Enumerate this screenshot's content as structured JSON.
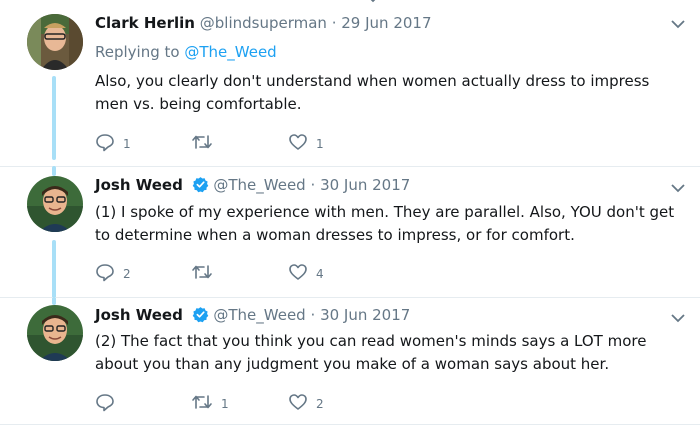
{
  "tweets": [
    {
      "name": "Clark Herlin",
      "handle": "@blindsuperman",
      "separator": "·",
      "date": "29 Jun 2017",
      "verified": false,
      "replying_prefix": "Replying to",
      "replying_to": "@The_Weed",
      "text": "Also, you clearly don't understand when women actually dress to impress men vs. being comfortable.",
      "reply_count": "1",
      "retweet_count": "",
      "like_count": "1"
    },
    {
      "name": "Josh Weed",
      "handle": "@The_Weed",
      "separator": "·",
      "date": "30 Jun 2017",
      "verified": true,
      "text": "(1) I spoke of my experience with men. They are parallel. Also, YOU don't get to determine when a woman dresses to impress, or for comfort.",
      "reply_count": "2",
      "retweet_count": "",
      "like_count": "4"
    },
    {
      "name": "Josh Weed",
      "handle": "@The_Weed",
      "separator": "·",
      "date": "30 Jun 2017",
      "verified": true,
      "text": "(2) The fact that you think you can read women's minds says a LOT more about you than any judgment you make of a woman says about her.",
      "reply_count": "",
      "retweet_count": "1",
      "like_count": "2"
    }
  ],
  "icons": {
    "reply": "reply-icon",
    "retweet": "retweet-icon",
    "like": "heart-icon",
    "more": "chevron-down-icon",
    "verified": "verified-badge-icon"
  },
  "colors": {
    "name": "#14171a",
    "secondary": "#657786",
    "link": "#1da1f2",
    "thread_line": "#a8dff7",
    "divider": "#e6ecf0"
  }
}
